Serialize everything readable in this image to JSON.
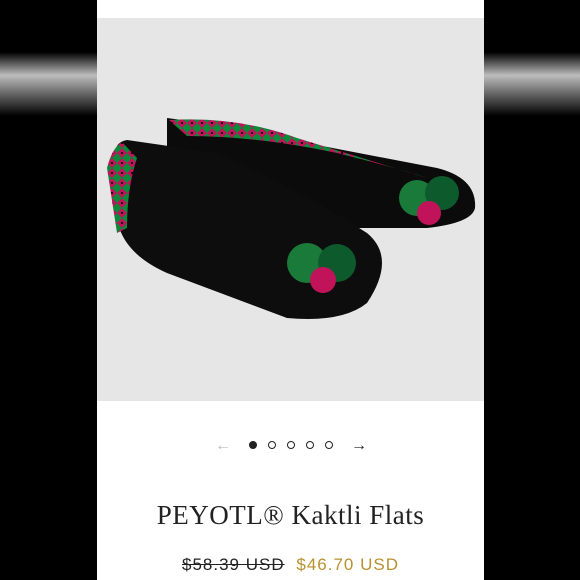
{
  "product": {
    "title": "PEYOTL® Kaktli Flats",
    "original_price": "$58.39 USD",
    "sale_price": "$46.70 USD",
    "image_alt": "Black pointed flats with green and pink tassels"
  },
  "carousel": {
    "prev_icon": "←",
    "next_icon": "→",
    "dot_count": 5,
    "active_index": 0
  },
  "colors": {
    "sale_price": "#b8912f",
    "text": "#222222",
    "photo_bg": "#e6e6e6"
  }
}
